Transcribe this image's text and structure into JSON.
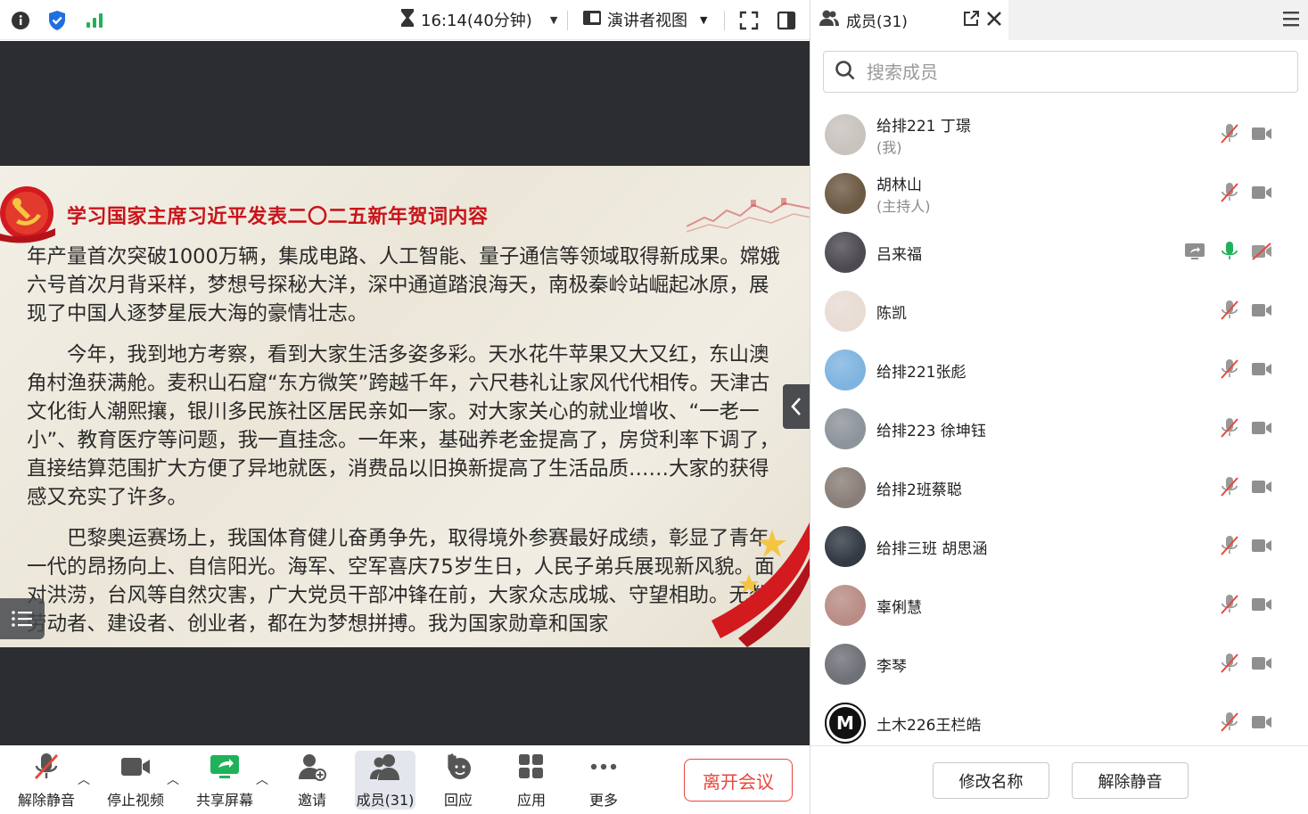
{
  "topbar": {
    "icons": [
      "info-icon",
      "shield-check-icon",
      "signal-icon",
      "hourglass-icon",
      "presenter-view-icon",
      "fullscreen-icon",
      "sidebar-toggle-icon"
    ],
    "timer_text": "16:14(40分钟)",
    "view_label": "演讲者视图"
  },
  "slide": {
    "title": "学习国家主席习近平发表二〇二五新年贺词内容",
    "paragraphs": [
      "年产量首次突破1000万辆，集成电路、人工智能、量子通信等领域取得新成果。嫦娥六号首次月背采样，梦想号探秘大洋，深中通道踏浪海天，南极秦岭站崛起冰原，展现了中国人逐梦星辰大海的豪情壮志。",
      "　　今年，我到地方考察，看到大家生活多姿多彩。天水花牛苹果又大又红，东山澳角村渔获满舱。麦积山石窟“东方微笑”跨越千年，六尺巷礼让家风代代相传。天津古文化街人潮熙攘，银川多民族社区居民亲如一家。对大家关心的就业增收、“一老一小”、教育医疗等问题，我一直挂念。一年来，基础养老金提高了，房贷利率下调了，直接结算范围扩大方便了异地就医，消费品以旧换新提高了生活品质……大家的获得感又充实了许多。",
      "　　巴黎奥运赛场上，我国体育健儿奋勇争先，取得境外参赛最好成绩，彰显了青年一代的昂扬向上、自信阳光。海军、空军喜庆75岁生日，人民子弟兵展现新风貌。面对洪涝，台风等自然灾害，广大党员干部冲锋在前，大家众志成城、守望相助。无数劳动者、建设者、创业者，都在为梦想拼搏。我为国家勋章和国家"
    ]
  },
  "toolbar": {
    "unmute_label": "解除静音",
    "stop_video_label": "停止视频",
    "share_label": "共享屏幕",
    "invite_label": "邀请",
    "members_label": "成员(31)",
    "react_label": "回应",
    "apps_label": "应用",
    "more_label": "更多",
    "leave_label": "离开会议"
  },
  "panel": {
    "tab_label": "成员(31)",
    "search_placeholder": "搜索成员",
    "members": [
      {
        "name": "给排221 丁璟",
        "role": "(我)",
        "mic": "muted",
        "video": "on",
        "sharing": false,
        "avatar": "#c9c3be"
      },
      {
        "name": "胡林山",
        "role": "(主持人)",
        "mic": "muted",
        "video": "on",
        "sharing": false,
        "avatar": "#6d5a44"
      },
      {
        "name": "吕来福",
        "role": "",
        "mic": "active",
        "video": "off",
        "sharing": true,
        "avatar": "#4d4a52"
      },
      {
        "name": "陈凯",
        "role": "",
        "mic": "muted",
        "video": "on",
        "sharing": false,
        "avatar": "#e8dcd4"
      },
      {
        "name": "给排221张彪",
        "role": "",
        "mic": "muted",
        "video": "on",
        "sharing": false,
        "avatar": "#7fb4e0"
      },
      {
        "name": "给排223 徐坤钰",
        "role": "",
        "mic": "muted",
        "video": "on",
        "sharing": false,
        "avatar": "#8e949c"
      },
      {
        "name": "给排2班蔡聪",
        "role": "",
        "mic": "muted",
        "video": "on",
        "sharing": false,
        "avatar": "#8a7f78"
      },
      {
        "name": "给排三班 胡思涵",
        "role": "",
        "mic": "muted",
        "video": "on",
        "sharing": false,
        "avatar": "#333a44"
      },
      {
        "name": "辜俐慧",
        "role": "",
        "mic": "muted",
        "video": "on",
        "sharing": false,
        "avatar": "#b98d86"
      },
      {
        "name": "李琴",
        "role": "",
        "mic": "muted",
        "video": "on",
        "sharing": false,
        "avatar": "#6f7178"
      },
      {
        "name": "土木226王栏皓",
        "role": "",
        "mic": "muted",
        "video": "on",
        "sharing": false,
        "avatar": "#ffffff"
      }
    ],
    "rename_label": "修改名称",
    "unmute_all_label": "解除静音"
  },
  "colors": {
    "accent_green": "#1fb25a",
    "muted_red": "#e8463c",
    "brand_blue": "#1f6fe0",
    "slide_title_red": "#c8141a"
  }
}
